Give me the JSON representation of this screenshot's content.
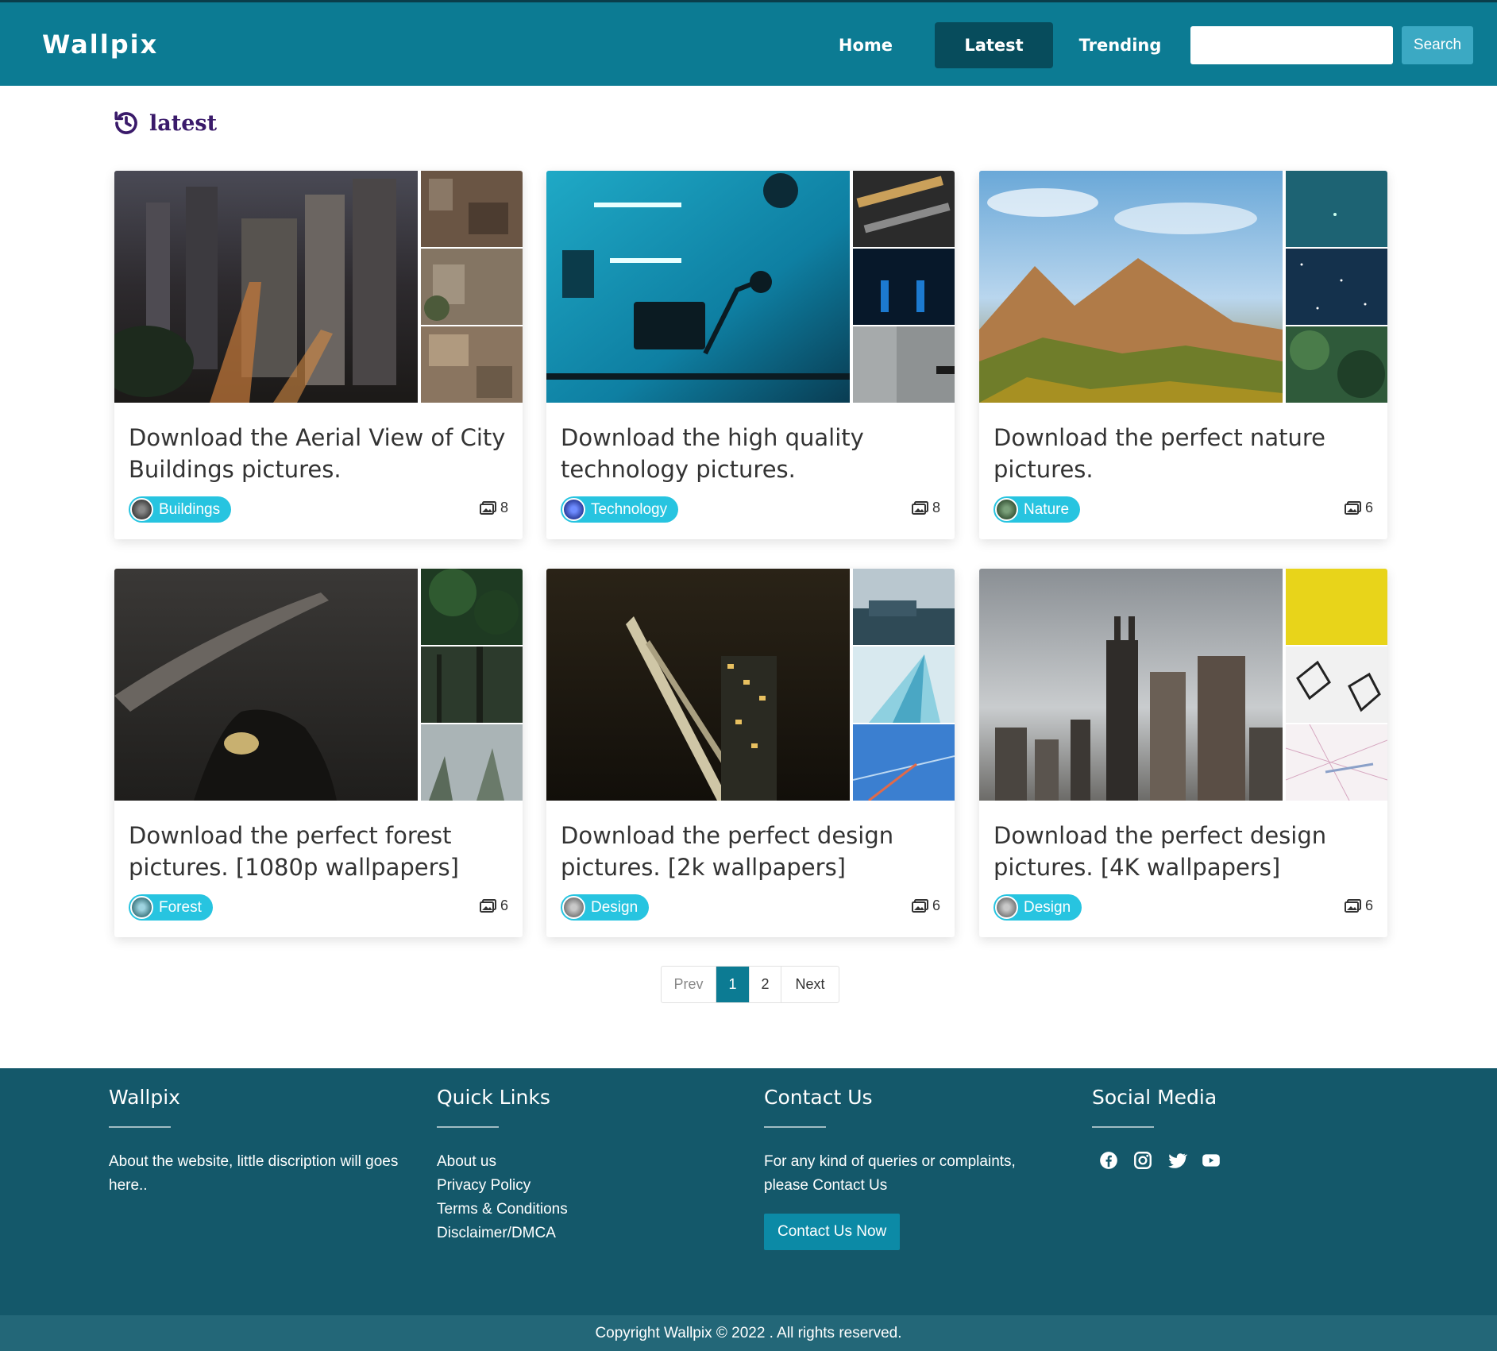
{
  "header": {
    "brand": "Wallpix",
    "nav": {
      "home": "Home",
      "latest": "Latest",
      "trending": "Trending"
    },
    "search": {
      "value": "",
      "button": "Search"
    }
  },
  "section": {
    "title": "latest",
    "icon": "history-icon"
  },
  "cards": [
    {
      "title": "Download the Aerial View of City Buildings pictures.",
      "tag": "Buildings",
      "count": "8"
    },
    {
      "title": "Download the high quality technology pictures.",
      "tag": "Technology",
      "count": "8"
    },
    {
      "title": "Download the perfect nature pictures.",
      "tag": "Nature",
      "count": "6"
    },
    {
      "title": "Download the perfect forest pictures. [1080p wallpapers]",
      "tag": "Forest",
      "count": "6"
    },
    {
      "title": "Download the perfect design pictures. [2k wallpapers]",
      "tag": "Design",
      "count": "6"
    },
    {
      "title": "Download the perfect design pictures. [4K wallpapers]",
      "tag": "Design",
      "count": "6"
    }
  ],
  "pagination": {
    "prev": "Prev",
    "pages": [
      "1",
      "2"
    ],
    "next": "Next",
    "active": "1"
  },
  "footer": {
    "about": {
      "heading": "Wallpix",
      "text": "About the website, little discription will goes here.."
    },
    "links": {
      "heading": "Quick Links",
      "items": [
        "About us",
        "Privacy Policy",
        "Terms & Conditions",
        "Disclaimer/DMCA"
      ]
    },
    "contact": {
      "heading": "Contact Us",
      "text": "For any kind of queries or complaints, please Contact Us",
      "button": "Contact Us Now"
    },
    "social": {
      "heading": "Social Media",
      "icons": [
        "facebook-icon",
        "instagram-icon",
        "twitter-icon",
        "youtube-icon"
      ]
    },
    "copyright": "Copyright Wallpix © 2022 . All rights reserved."
  },
  "colors": {
    "header": "#0c7b93",
    "active_nav": "#074c5c",
    "tag": "#27c4e0",
    "footer": "#14586a",
    "copyright_bar": "#236778"
  }
}
